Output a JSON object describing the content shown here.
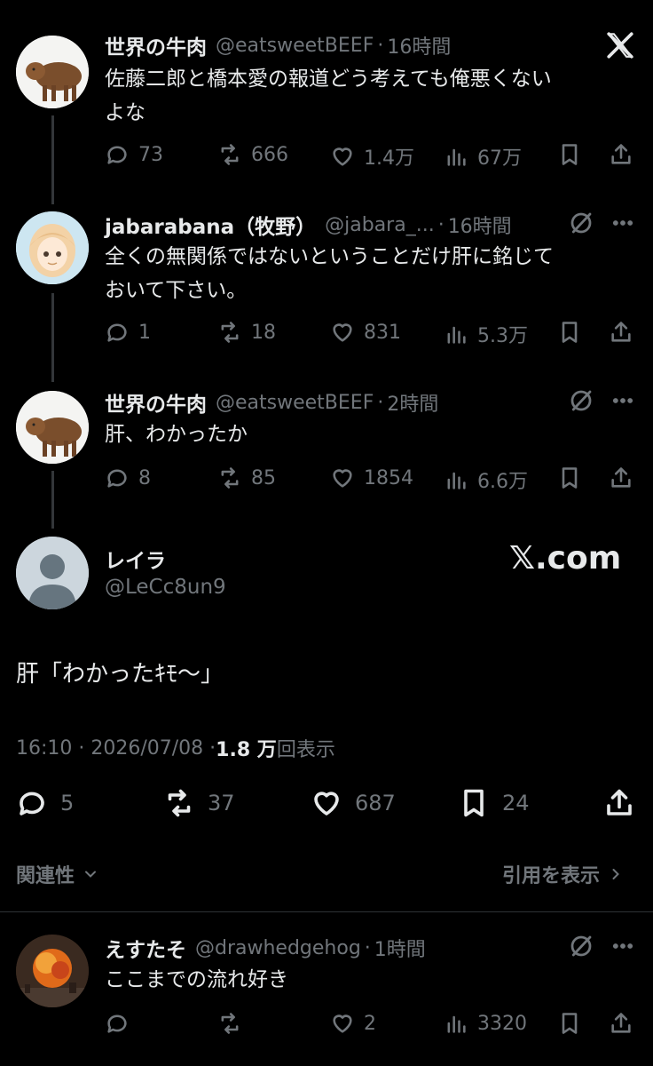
{
  "tweets": [
    {
      "name": "世界の牛肉",
      "handle": "@eatsweetBEEF",
      "time": "16時間",
      "lines": [
        "佐藤二郎と橋本愛の報道どう考えても俺悪くない",
        "よな"
      ],
      "replies": "73",
      "retweets": "666",
      "likes": "1.4万",
      "views": "67万"
    },
    {
      "name": "jabarabana（牧野）",
      "handle": "@jabara_...",
      "time": "16時間",
      "lines": [
        "全くの無関係ではないということだけ肝に銘じて",
        "おいて下さい。"
      ],
      "replies": "1",
      "retweets": "18",
      "likes": "831",
      "views": "5.3万"
    },
    {
      "name": "世界の牛肉",
      "handle": "@eatsweetBEEF",
      "time": "2時間",
      "lines": [
        "肝、わかったか"
      ],
      "replies": "8",
      "retweets": "85",
      "likes": "1854",
      "views": "6.6万"
    }
  ],
  "main": {
    "name": "レイラ",
    "handle": "@LeCc8un9",
    "watermark": "𝕏.com",
    "text": "肝「わかったｷﾓ〜」",
    "timestamp": "16:10 · 2026/07/08 · ",
    "views_count": "1.8 万",
    "views_label": "回表示",
    "replies": "5",
    "retweets": "37",
    "likes": "687",
    "bookmarks": "24"
  },
  "filters": {
    "relevance": "関連性",
    "quotes": "引用を表示"
  },
  "reply": {
    "name": "えすたそ",
    "handle": "@drawhedgehog",
    "time": "1時間",
    "text": "ここまでの流れ好き",
    "replies": "",
    "retweets": "",
    "likes": "2",
    "views": "3320"
  },
  "separator": "·",
  "logo": "X"
}
